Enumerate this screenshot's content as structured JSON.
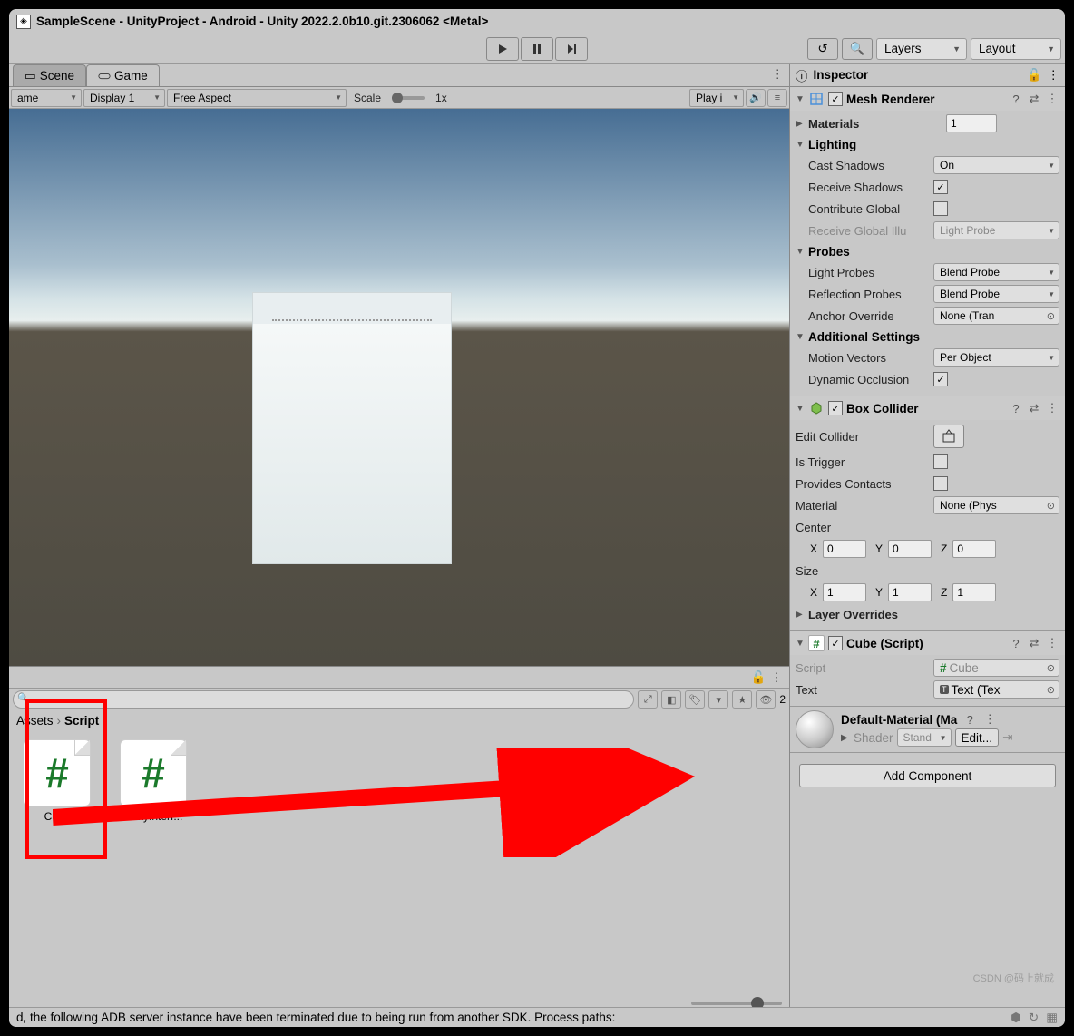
{
  "window": {
    "title": "SampleScene - UnityProject - Android - Unity 2022.2.0b10.git.2306062 <Metal>"
  },
  "toolbar": {
    "layers": "Layers",
    "layout": "Layout"
  },
  "tabs": {
    "scene": "Scene",
    "game": "Game"
  },
  "game_toolbar": {
    "mode": "ame",
    "display": "Display 1",
    "aspect": "Free Aspect",
    "scale_label": "Scale",
    "scale_value": "1x",
    "play": "Play i"
  },
  "project": {
    "breadcrumb_root": "Assets",
    "breadcrumb_current": "Script",
    "assets": [
      {
        "label": "Cube"
      },
      {
        "label": "UnityInterf..."
      }
    ],
    "hidden_count": "2"
  },
  "inspector": {
    "tab": "Inspector",
    "mesh_renderer": {
      "title": "Mesh Renderer",
      "materials": "Materials",
      "materials_count": "1",
      "lighting": "Lighting",
      "cast_shadows": "Cast Shadows",
      "cast_shadows_v": "On",
      "receive_shadows": "Receive Shadows",
      "contribute_global": "Contribute Global",
      "receive_global": "Receive Global Illu",
      "receive_global_v": "Light Probe",
      "probes": "Probes",
      "light_probes": "Light Probes",
      "light_probes_v": "Blend Probe",
      "reflection_probes": "Reflection Probes",
      "reflection_probes_v": "Blend Probe",
      "anchor_override": "Anchor Override",
      "anchor_override_v": "None (Tran",
      "additional": "Additional Settings",
      "motion_vectors": "Motion Vectors",
      "motion_vectors_v": "Per Object",
      "dynamic_occlusion": "Dynamic Occlusion"
    },
    "box_collider": {
      "title": "Box Collider",
      "edit_collider": "Edit Collider",
      "is_trigger": "Is Trigger",
      "provides_contacts": "Provides Contacts",
      "material": "Material",
      "material_v": "None (Phys",
      "center": "Center",
      "center_x": "0",
      "center_y": "0",
      "center_z": "0",
      "size": "Size",
      "size_x": "1",
      "size_y": "1",
      "size_z": "1",
      "layer_overrides": "Layer Overrides"
    },
    "cube_script": {
      "title": "Cube (Script)",
      "script": "Script",
      "script_v": "Cube",
      "text": "Text",
      "text_v": "Text (Tex"
    },
    "material": {
      "title": "Default-Material (Ma",
      "shader": "Shader",
      "shader_v": "Stand",
      "edit": "Edit..."
    },
    "add_component": "Add Component"
  },
  "status": {
    "text": "d, the following ADB server instance have been terminated due to being run from another SDK. Process paths:"
  },
  "watermark": "CSDN @码上就成"
}
